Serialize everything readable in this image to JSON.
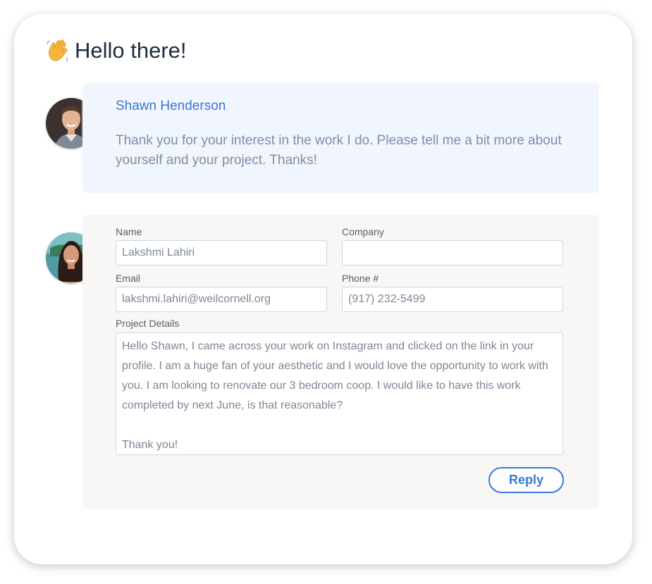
{
  "greeting": {
    "icon": "waving-hand-icon",
    "text": "Hello there!"
  },
  "message": {
    "sender": "Shawn Henderson",
    "text": "Thank you for your interest in the work I do. Please tell me a bit more about yourself and your project.  Thanks!",
    "avatar_icon": "man-portrait-avatar"
  },
  "reply_form": {
    "avatar_icon": "woman-portrait-avatar",
    "name_label": "Name",
    "name_value": "Lakshmi Lahiri",
    "company_label": "Company",
    "company_value": "",
    "email_label": "Email",
    "email_value": "lakshmi.lahiri@weilcornell.org",
    "phone_label": "Phone #",
    "phone_value": "(917) 232-5499",
    "details_label": "Project Details",
    "details_value": "Hello Shawn, I came across your work on Instagram and clicked on the link in your profile. I am a huge fan of your aesthetic and I would love the opportunity to work with you. I am looking to renovate our 3 bedroom coop. I would like to have this work completed by next June, is that reasonable?\n\nThank you!",
    "reply_label": "Reply"
  },
  "colors": {
    "accent": "#3a78d8",
    "heading": "#1f2b3d",
    "message_bg": "#f1f5fe",
    "form_bg": "#f8f7f6",
    "muted_text": "#7f8fa4"
  }
}
